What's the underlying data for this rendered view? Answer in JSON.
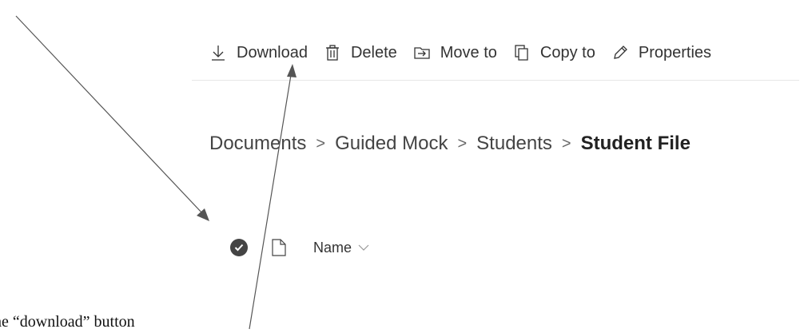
{
  "toolbar": {
    "download_label": "Download",
    "delete_label": "Delete",
    "move_label": "Move to",
    "copy_label": "Copy to",
    "properties_label": "Properties"
  },
  "breadcrumb": {
    "items": [
      "Documents",
      "Guided Mock",
      "Students",
      "Student File"
    ],
    "separator": ">"
  },
  "list": {
    "name_header": "Name"
  },
  "annotation": {
    "caption": "he “download” button"
  },
  "colors": {
    "text": "#333333",
    "check_fill": "#444444",
    "arrow": "#555555",
    "divider": "#e6e6e6"
  }
}
